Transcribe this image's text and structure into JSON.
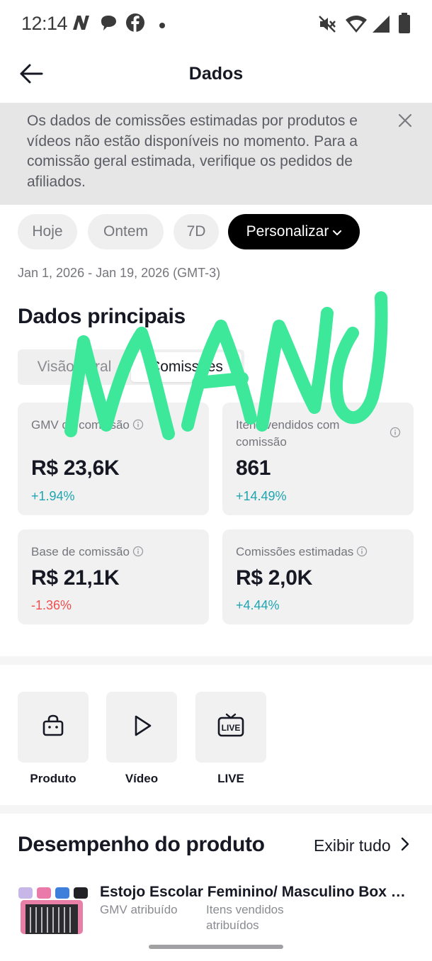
{
  "status_bar": {
    "time": "12:14",
    "icons": [
      "n-app-icon",
      "chat-bubble-icon",
      "facebook-icon",
      "dot-icon",
      "mute-icon",
      "wifi-icon",
      "signal-icon",
      "battery-icon"
    ]
  },
  "header": {
    "title": "Dados",
    "back_icon": "arrow-left-icon"
  },
  "notice": {
    "text": "Os dados de comissões estimadas por produtos e vídeos não estão disponíveis no momento. Para a comissão geral estimada, verifique os pedidos de afiliados.",
    "close_icon": "close-icon"
  },
  "date_filters": [
    {
      "label": "Hoje",
      "active": false
    },
    {
      "label": "Ontem",
      "active": false
    },
    {
      "label": "7D",
      "active": false
    },
    {
      "label": "Personalizar",
      "active": true
    }
  ],
  "date_range": "Jan 1, 2026 - Jan 19, 2026 (GMT-3)",
  "main_data": {
    "title": "Dados principais",
    "tabs": [
      {
        "label": "Visão geral",
        "active": false
      },
      {
        "label": "Comissões",
        "active": true
      }
    ],
    "metrics": [
      {
        "label": "GMV da comissão",
        "value": "R$ 23,6K",
        "change": "+1.94%",
        "trend": "positive"
      },
      {
        "label": "Itens vendidos com comissão",
        "value": "861",
        "change": "+14.49%",
        "trend": "positive"
      },
      {
        "label": "Base de comissão",
        "value": "R$ 21,1K",
        "change": "-1.36%",
        "trend": "negative"
      },
      {
        "label": "Comissões estimadas",
        "value": "R$ 2,0K",
        "change": "+4.44%",
        "trend": "positive"
      }
    ]
  },
  "shortcuts": [
    {
      "label": "Produto",
      "icon": "shopping-bag-icon"
    },
    {
      "label": "Vídeo",
      "icon": "play-icon"
    },
    {
      "label": "LIVE",
      "icon": "live-tv-icon"
    }
  ],
  "product_performance": {
    "title": "Desempenho do produto",
    "see_all": "Exibir tudo",
    "items": [
      {
        "name": "Estojo Escolar Feminino/ Masculino Box Multifuncional",
        "col1": "GMV atribuído",
        "col2": "Itens vendidos atribuídos"
      }
    ]
  },
  "overlay": {
    "handwriting": "MANO",
    "color": "#3de89a"
  },
  "colors": {
    "accent_positive": "#1ea5b0",
    "accent_negative": "#ee4f4f",
    "chip_active": "#000000",
    "notice_bg": "#e6e6e7"
  }
}
